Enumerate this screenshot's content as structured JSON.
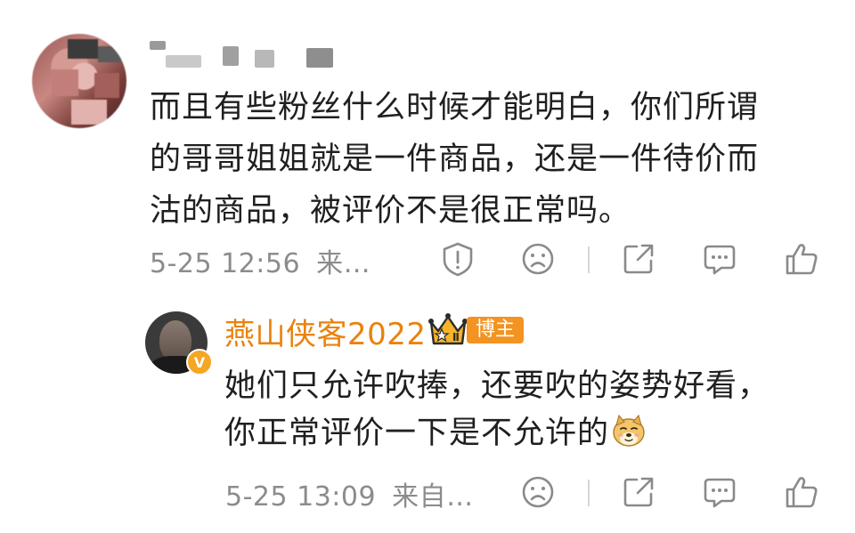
{
  "comment": {
    "text_lines": [
      "而且有些粉丝什么时候才能明白，你们所谓",
      "的哥哥姐姐就是一件商品，还是一件待价而",
      "沽的商品，被评价不是很正常吗。"
    ],
    "time": "5-25 12:56",
    "source": "来…",
    "actions": [
      "report-icon",
      "frown-icon",
      "share-icon",
      "comment-icon",
      "like-icon"
    ]
  },
  "reply": {
    "username": "燕山侠客2022",
    "level_badge": "Ⅱ",
    "role_badge": "博主",
    "verified_mark": "V",
    "text_lines": [
      "她们只允许吹捧，还要吹的姿势好看，",
      "你正常评价一下是不允许的"
    ],
    "time": "5-25 13:09",
    "source": "来自…",
    "actions": [
      "frown-icon",
      "share-icon",
      "comment-icon",
      "like-icon"
    ]
  },
  "colors": {
    "username_orange": "#e9820c",
    "badge_orange": "#f39321",
    "meta_gray": "#8c8c8c",
    "icon_gray": "#8a8a8a"
  }
}
